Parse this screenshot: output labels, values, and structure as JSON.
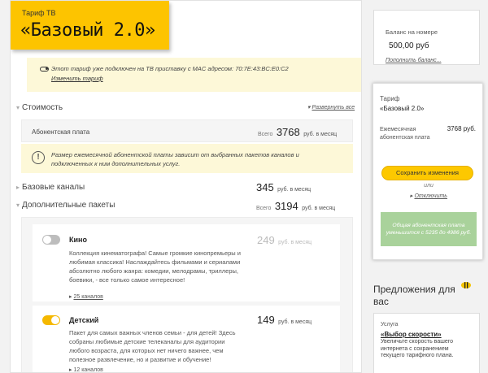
{
  "tariff": {
    "label": "Тариф ТВ",
    "name": "«Базовый 2.0»"
  },
  "notice": {
    "text": "Этот тариф уже подключен на ТВ приставку с MAC адресом: 70:7E:43:BC:E0:C2",
    "change_link": "Изменить тариф"
  },
  "cost_section": {
    "title": "Стоимость",
    "expand_link": "Развернуть все",
    "fee_label": "Абонентская плата",
    "total_prefix": "Всего",
    "total_value": "3768",
    "unit": "руб. в месяц"
  },
  "warning": {
    "icon": "exclamation-icon",
    "text": "Размер ежемесячной абонентской платы зависит от выбранных пакетов каналов и подключенных к ним дополнительных услуг."
  },
  "base_channels": {
    "title": "Базовые каналы",
    "value": "345",
    "unit": "руб. в месяц"
  },
  "additional": {
    "title": "Дополнительные пакеты",
    "total_prefix": "Всего",
    "total_value": "3194",
    "unit": "руб. в месяц"
  },
  "packages": [
    {
      "name": "Кино",
      "enabled": false,
      "price": "249",
      "unit": "руб. в месяц",
      "description": "Коллекция кинематографа! Самые громкие кинопремьеры и любимая классика! Наслаждайтесь фильмами и сериалами абсолютно любого жанра: комедии, мелодрамы, триллеры, боевики, - все только самое интересное!",
      "count": "25 каналов"
    },
    {
      "name": "Детский",
      "enabled": true,
      "price": "149",
      "unit": "руб. в месяц",
      "description": "Пакет для самых важных членов семьи - для детей! Здесь собраны любимые детские телеканалы для аудитории любого возраста, для которых нет ничего важнее, чем полезное развлечение, но и развитие и обучение!",
      "count": "12 каналов"
    }
  ],
  "balance": {
    "label": "Баланс на номере",
    "value": "500,00 руб",
    "topup_link": "Пополнить баланс..."
  },
  "summary": {
    "label": "Тариф",
    "name": "«Базовый 2.0»",
    "fee_label": "Ежемесячная абонентская плата",
    "fee_value": "3768 руб.",
    "save_button": "Сохранить изменения",
    "or": "или",
    "cancel_link": "Отключить",
    "change_note": "Общая абонентская плата уменьшится с 5235 до 4986 руб."
  },
  "offers": {
    "title": "Предложения для вас",
    "card": {
      "label": "Услуга",
      "name": "«Выбор скорости»",
      "description": "Увеличьте скорость вашего интернета с сохранением текущего тарифного плана."
    }
  },
  "colors": {
    "accent": "#fdc400",
    "notice_bg": "#fdf8d8",
    "success_bg": "#a9d29b"
  }
}
